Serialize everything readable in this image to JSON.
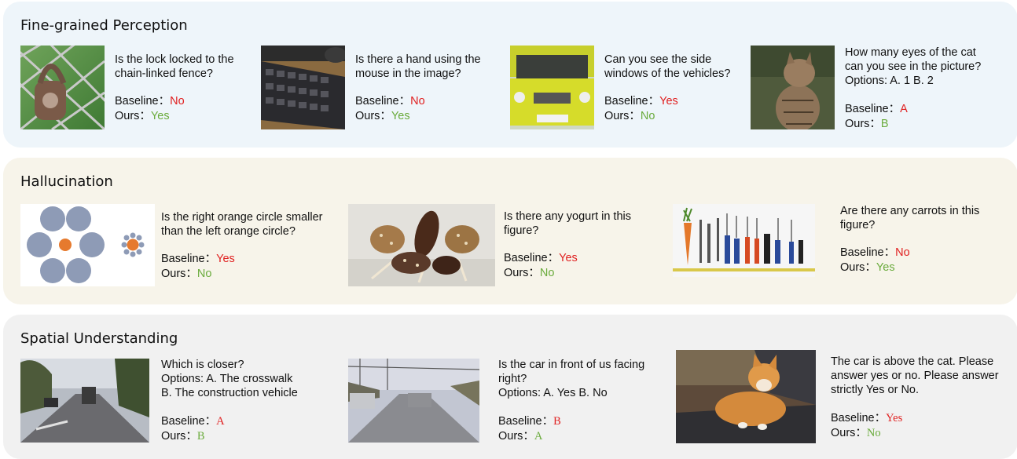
{
  "sections": [
    {
      "title": "Fine-grained Perception",
      "items": [
        {
          "question": [
            "Is the lock locked to the",
            "chain-linked fence?"
          ],
          "baseline_label": "Baseline：",
          "baseline": "No",
          "ours_label": "Ours：",
          "ours": "Yes"
        },
        {
          "question": [
            "Is there a hand using the",
            "mouse in the image?"
          ],
          "baseline_label": "Baseline：",
          "baseline": "No",
          "ours_label": "Ours：",
          "ours": "Yes"
        },
        {
          "question": [
            "Can you see the side",
            "windows of the vehicles?"
          ],
          "baseline_label": "Baseline：",
          "baseline": "Yes",
          "ours_label": "Ours：",
          "ours": "No"
        },
        {
          "question": [
            "How many eyes of the cat",
            "can you see in the picture?",
            "Options:  A. 1  B. 2"
          ],
          "baseline_label": "Baseline：",
          "baseline": "A",
          "ours_label": "Ours：",
          "ours": "B"
        }
      ]
    },
    {
      "title": "Hallucination",
      "items": [
        {
          "question": [
            "Is the right orange circle smaller",
            "than the left orange circle?"
          ],
          "baseline_label": "Baseline：",
          "baseline": "Yes",
          "ours_label": "Ours：",
          "ours": "No"
        },
        {
          "question": [
            "Is there any yogurt in this",
            "figure?"
          ],
          "baseline_label": "Baseline：",
          "baseline": "Yes",
          "ours_label": "Ours：",
          "ours": "No"
        },
        {
          "question": [
            "Are there any carrots in this",
            "figure?"
          ],
          "baseline_label": "Baseline：",
          "baseline": "No",
          "ours_label": "Ours：",
          "ours": "Yes"
        }
      ]
    },
    {
      "title": "Spatial Understanding",
      "items": [
        {
          "question": [
            "Which is closer?",
            "Options: A. The crosswalk",
            "B. The  construction vehicle"
          ],
          "baseline_label": "Baseline：",
          "baseline": "A",
          "ours_label": "Ours：",
          "ours": "B"
        },
        {
          "question": [
            "Is the car in front of us facing",
            "right?",
            "Options: A. Yes   B. No"
          ],
          "baseline_label": "Baseline：",
          "baseline": "B",
          "ours_label": "Ours：",
          "ours": "A"
        },
        {
          "question": [
            "The car is above the cat. Please",
            "answer yes or no. Please answer",
            "strictly Yes or No."
          ],
          "baseline_label": "Baseline：",
          "baseline": "Yes",
          "ours_label": "Ours：",
          "ours": "No"
        }
      ]
    }
  ],
  "colors": {
    "wrong": "#e02020",
    "right": "#6aab3c",
    "panel1": "#eef5fa",
    "panel2": "#f7f4ea",
    "panel3": "#f1f1f1"
  },
  "image_subjects": [
    "padlock on chain-link fence",
    "computer keyboard",
    "yellow van front",
    "tabby cat",
    "circle size illusion",
    "chocolate ice cream bars",
    "tools and a carrot",
    "road with construction vehicle",
    "road with cars",
    "orange cat on car hood"
  ]
}
